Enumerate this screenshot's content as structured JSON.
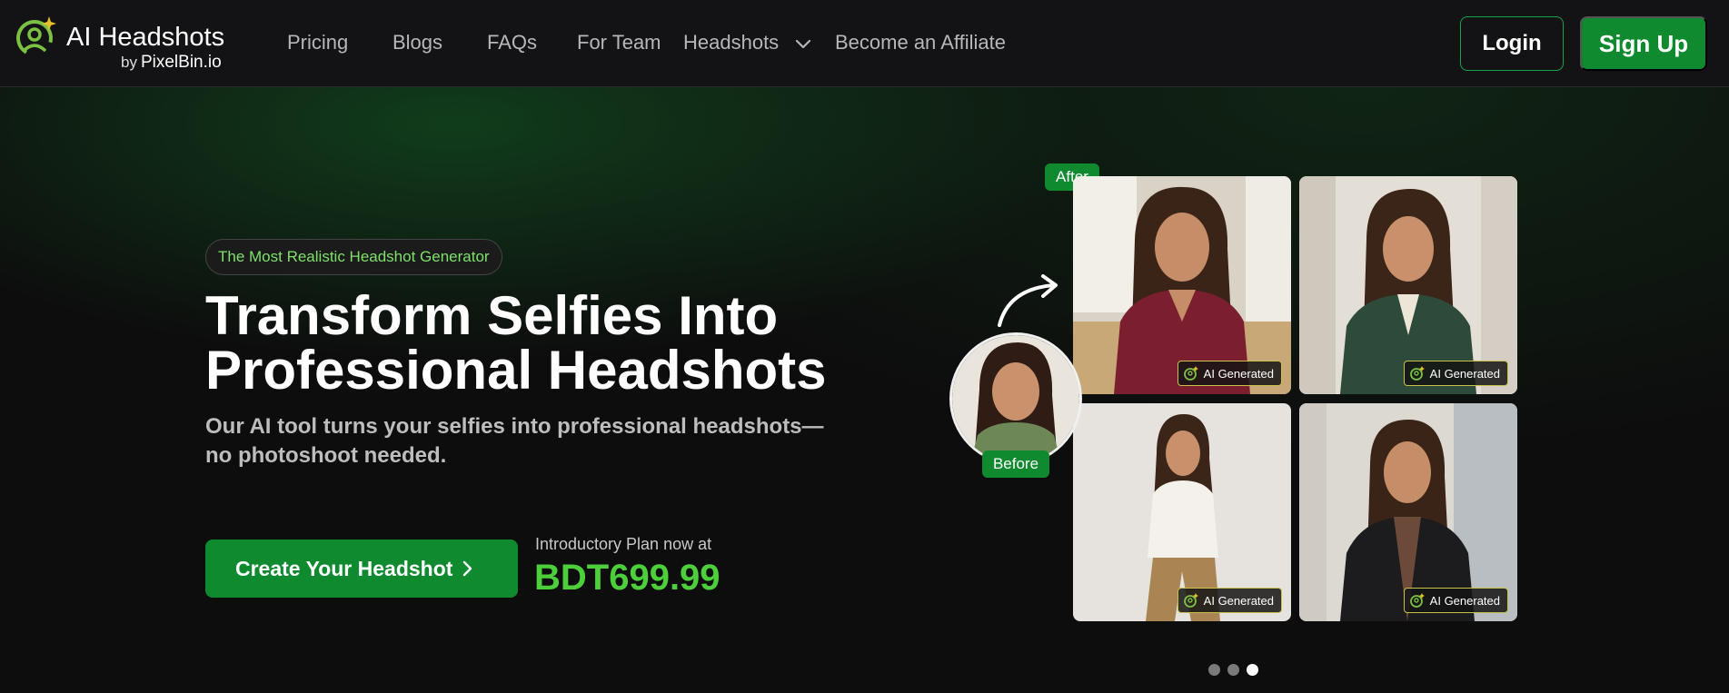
{
  "brand": {
    "title": "AI Headshots",
    "by": "by",
    "company": "PixelBin.io",
    "accent_color": "#0f8a2e",
    "logo_colors": [
      "#7cc242",
      "#e6c02a"
    ]
  },
  "nav": {
    "links": [
      "Pricing",
      "Blogs",
      "FAQs",
      "For Team",
      "Headshots",
      "Become an Affiliate"
    ],
    "login_label": "Login",
    "signup_label": "Sign Up"
  },
  "hero": {
    "pill": "The Most Realistic Headshot Generator",
    "headline_line1": "Transform Selfies Into",
    "headline_line2": "Professional Headshots",
    "subhead_line1": "Our AI tool turns your selfies into professional headshots—",
    "subhead_line2": "no photoshoot needed.",
    "cta_label": "Create Your Headshot",
    "intro_label": "Introductory Plan now at",
    "price": "BDT699.99",
    "price_color": "#4ccf3b"
  },
  "gallery": {
    "after_label": "After",
    "before_label": "Before",
    "badge_label": "AI Generated",
    "outfits": [
      "burgundy-blouse",
      "green-blazer",
      "white-blazer",
      "black-blazer"
    ]
  },
  "carousel": {
    "dot_count": 3,
    "active_index": 2
  }
}
